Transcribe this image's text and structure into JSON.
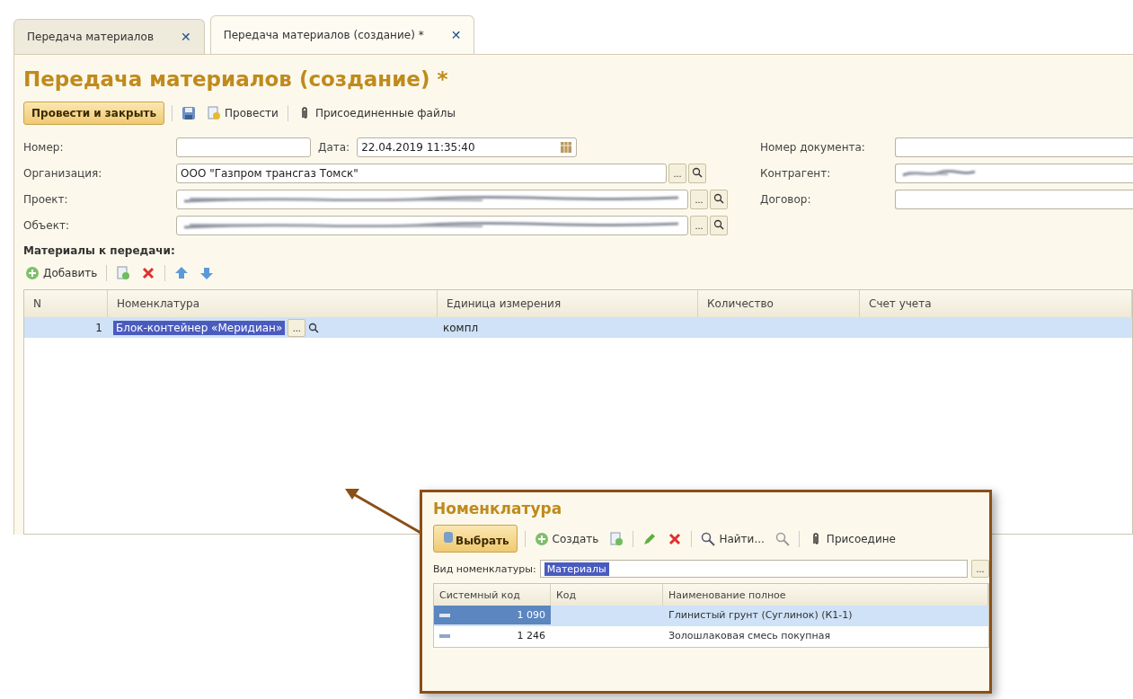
{
  "tabs": [
    {
      "label": "Передача материалов",
      "selected": false,
      "close": "✕"
    },
    {
      "label": "Передача материалов (создание) *",
      "selected": true,
      "close": "✕"
    }
  ],
  "form": {
    "title": "Передача материалов (создание) *",
    "toolbar": [
      {
        "kind": "primary",
        "label": "Провести и закрыть"
      },
      {
        "kind": "save"
      },
      {
        "kind": "post",
        "label": "Провести"
      },
      {
        "kind": "attach",
        "label": "Присоединенные файлы"
      }
    ],
    "fields_left": [
      {
        "label": "Номер:",
        "kind": "short"
      },
      {
        "label": "Организация:",
        "kind": "ref",
        "value": "ООО \"Газпром трансгаз Томск\"",
        "button": "...",
        "redacted": false
      },
      {
        "label": "Проект:",
        "kind": "ref",
        "redacted": true,
        "button": "..."
      },
      {
        "label": "Объект:",
        "kind": "ref",
        "redacted": true,
        "button": "..."
      }
    ],
    "date": {
      "label": "Дата:",
      "value": "22.04.2019 11:35:40"
    },
    "fields_right": [
      {
        "label": "Номер документа:",
        "redacted": false
      },
      {
        "label": "Контрагент:",
        "redacted": true
      },
      {
        "label": "Договор:",
        "redacted": false
      }
    ],
    "section": "Материалы к передачи:",
    "table_toolbar": [
      {
        "kind": "add",
        "label": "Добавить"
      },
      {
        "kind": "copy"
      },
      {
        "kind": "delete"
      },
      {
        "kind": "up"
      },
      {
        "kind": "down"
      }
    ],
    "table": {
      "columns": [
        "N",
        "Номенклатура",
        "Единица измерения",
        "Количество",
        "Счет учета"
      ],
      "rows": [
        {
          "n": "1",
          "item": "Блок-контейнер «Меридиан»",
          "unit": "компл",
          "button": "...",
          "selected": true
        }
      ]
    }
  },
  "popup": {
    "title": "Номенклатура",
    "toolbar": [
      {
        "kind": "primary",
        "label": "Выбрать"
      },
      {
        "kind": "add",
        "label": "Создать"
      },
      {
        "kind": "copy"
      },
      {
        "kind": "edit"
      },
      {
        "kind": "delete"
      },
      {
        "kind": "find",
        "label": "Найти..."
      },
      {
        "kind": "clear"
      },
      {
        "kind": "attach",
        "label": "Присоедине"
      }
    ],
    "filter": {
      "label": "Вид номенклатуры:",
      "value": "Материалы",
      "button": "..."
    },
    "columns": [
      "Системный код",
      "Код",
      "Наименование полное"
    ],
    "rows": [
      {
        "code": "1 090",
        "name": "Глинистый грунт (Суглинок) (К1-1)",
        "selected": true
      },
      {
        "code": "1 246",
        "name": "Золошлаковая смесь покупная",
        "selected": false
      }
    ]
  }
}
